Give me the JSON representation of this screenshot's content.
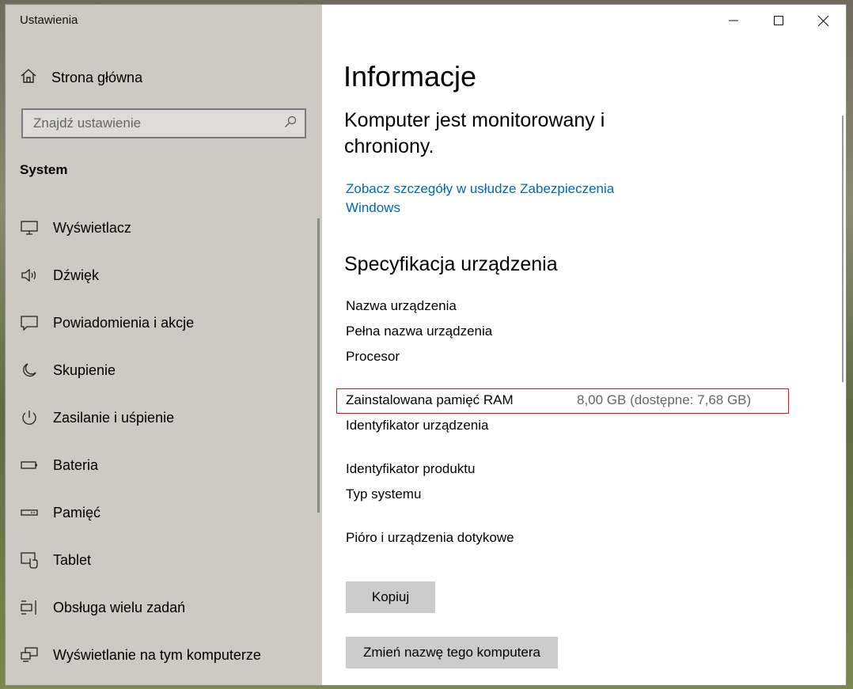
{
  "app_title": "Ustawienia",
  "home_label": "Strona główna",
  "search": {
    "placeholder": "Znajdź ustawienie"
  },
  "section_label": "System",
  "nav": [
    {
      "label": "Wyświetlacz",
      "icon": "monitor-icon"
    },
    {
      "label": "Dźwięk",
      "icon": "speaker-icon"
    },
    {
      "label": "Powiadomienia i akcje",
      "icon": "notification-icon"
    },
    {
      "label": "Skupienie",
      "icon": "moon-icon"
    },
    {
      "label": "Zasilanie i uśpienie",
      "icon": "power-icon"
    },
    {
      "label": "Bateria",
      "icon": "battery-icon"
    },
    {
      "label": "Pamięć",
      "icon": "storage-icon"
    },
    {
      "label": "Tablet",
      "icon": "tablet-icon"
    },
    {
      "label": "Obsługa wielu zadań",
      "icon": "multitasking-icon"
    },
    {
      "label": "Wyświetlanie na tym komputerze",
      "icon": "projecting-icon"
    }
  ],
  "main": {
    "title": "Informacje",
    "status": "Komputer jest monitorowany i chroniony.",
    "security_link": "Zobacz szczegóły w usłudze Zabezpieczenia Windows",
    "spec_title": "Specyfikacja urządzenia",
    "specs": [
      {
        "label": "Nazwa urządzenia",
        "value": ""
      },
      {
        "label": "Pełna nazwa urządzenia",
        "value": ""
      },
      {
        "label": "Procesor",
        "value": ""
      },
      {
        "label": "Zainstalowana pamięć RAM",
        "value": "8,00 GB (dostępne: 7,68 GB)"
      },
      {
        "label": "Identyfikator urządzenia",
        "value": ""
      },
      {
        "label": "Identyfikator produktu",
        "value": ""
      },
      {
        "label": "Typ systemu",
        "value": ""
      },
      {
        "label": "Pióro i urządzenia dotykowe",
        "value": ""
      }
    ],
    "copy_button": "Kopiuj",
    "rename_button": "Zmień nazwę tego komputera"
  }
}
